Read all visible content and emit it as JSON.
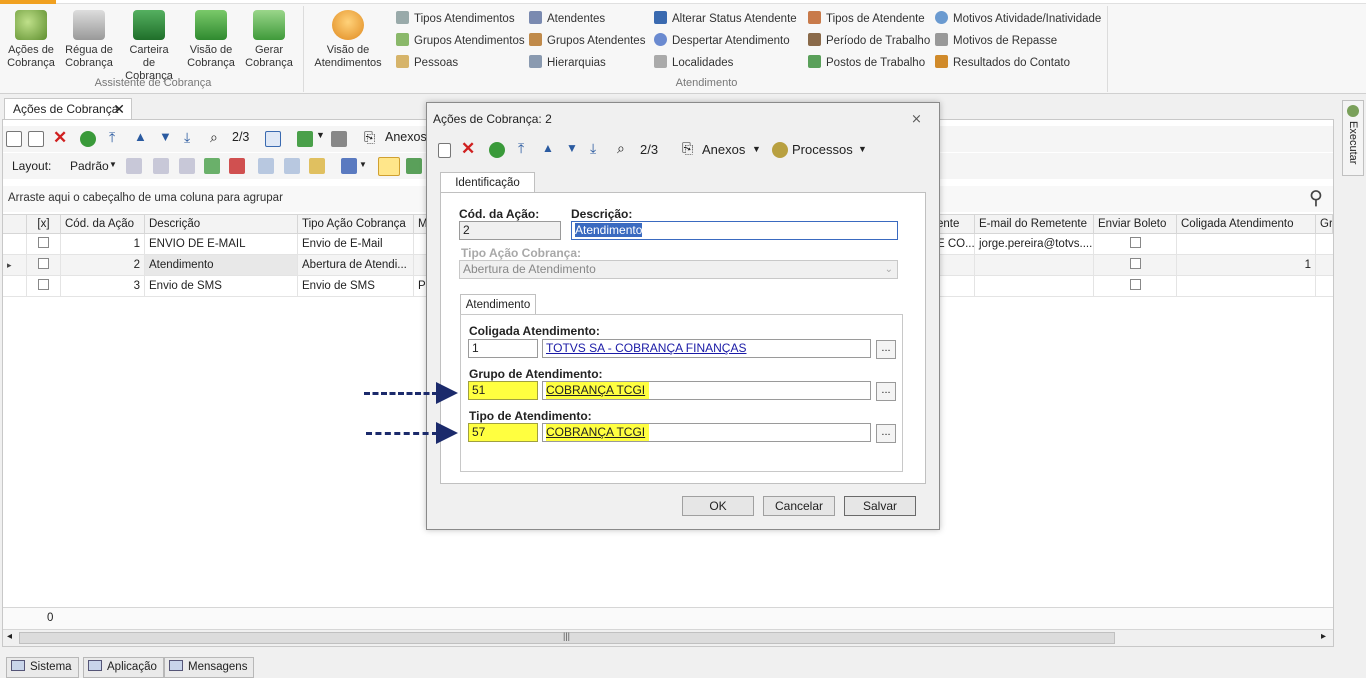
{
  "ribbon": {
    "group1": {
      "label": "Assistente de Cobrança",
      "buttons": [
        {
          "label1": "Ações de",
          "label2": "Cobrança",
          "icon": "actions-icon",
          "color": "#6a9a3a"
        },
        {
          "label1": "Régua de",
          "label2": "Cobrança",
          "icon": "ruler-icon",
          "color": "#8a8a8a"
        },
        {
          "label1": "Carteira de",
          "label2": "Cobrança",
          "icon": "wallet-icon",
          "color": "#2e8b3a"
        },
        {
          "label1": "Visão de",
          "label2": "Cobrança",
          "icon": "money-icon",
          "color": "#3a9a3a"
        },
        {
          "label1": "Gerar",
          "label2": "Cobrança",
          "icon": "generate-icon",
          "color": "#4aa040"
        }
      ]
    },
    "group2": {
      "label": "Atendimento",
      "big_button": {
        "label1": "Visão de",
        "label2": "Atendimentos",
        "icon": "headset-icon"
      },
      "col1": [
        "Tipos Atendimentos",
        "Grupos Atendimentos",
        "Pessoas"
      ],
      "col2": [
        "Atendentes",
        "Grupos Atendentes",
        "Hierarquias"
      ],
      "col3": [
        "Alterar Status Atendente",
        "Despertar Atendimento",
        "Localidades"
      ],
      "col4": [
        "Tipos de Atendente",
        "Período de Trabalho",
        "Postos de Trabalho"
      ],
      "col5": [
        "Motivos Atividade/Inatividade",
        "Motivos de Repasse",
        "Resultados do Contato"
      ]
    }
  },
  "doc_tab": {
    "label": "Ações de Cobrança",
    "close": "✕"
  },
  "main_toolbar": {
    "record_counter": "2/3",
    "attachments": "Anexos"
  },
  "layout_bar": {
    "layout_label": "Layout:",
    "layout_value": "Padrão"
  },
  "group_hint": "Arraste aqui o cabeçalho de uma coluna para agrupar",
  "grid": {
    "headers": {
      "check": "[x]",
      "code": "Cód. da Ação",
      "desc": "Descrição",
      "type": "Tipo Ação Cobrança",
      "m": "M",
      "ente": "ente",
      "email": "E-mail do Remetente",
      "boleto": "Enviar Boleto",
      "coligada": "Coligada Atendimento",
      "gr": "Gr"
    },
    "rows": [
      {
        "code": "1",
        "desc": "ENVIO DE E-MAIL",
        "type": "Envio de E-Mail",
        "m": "",
        "ente": "E CO...",
        "email": "jorge.pereira@totvs....",
        "coligada": ""
      },
      {
        "code": "2",
        "desc": "Atendimento",
        "type": "Abertura de Atendi...",
        "m": "",
        "ente": "",
        "email": "",
        "coligada": "1"
      },
      {
        "code": "3",
        "desc": "Envio de SMS",
        "type": "Envio de SMS",
        "m": "Pr",
        "ente": "",
        "email": "",
        "coligada": ""
      }
    ],
    "footer_count": "0"
  },
  "dialog": {
    "title": "Ações de Cobrança: 2",
    "record_counter": "2/3",
    "attachments": "Anexos",
    "processes": "Processos",
    "tab_identificacao": "Identificação",
    "code_label": "Cód. da Ação:",
    "code_value": "2",
    "desc_label": "Descrição:",
    "desc_value": "Atendimento",
    "type_label": "Tipo Ação Cobrança:",
    "type_value": "Abertura de Atendimento",
    "tab_atendimento": "Atendimento",
    "coligada_label": "Coligada Atendimento:",
    "coligada_code": "1",
    "coligada_name": "TOTVS SA - COBRANÇA FINANÇAS",
    "grupo_label": "Grupo de Atendimento:",
    "grupo_code": "51",
    "grupo_name": "COBRANÇA TCGI",
    "tipo_label": "Tipo de Atendimento:",
    "tipo_code": "57",
    "tipo_name": "COBRANÇA TCGI",
    "ellipsis": "...",
    "ok": "OK",
    "cancel": "Cancelar",
    "save": "Salvar"
  },
  "side_panel": {
    "label": "Executar"
  },
  "status_bar": {
    "sistema": "Sistema",
    "aplicacao": "Aplicação",
    "mensagens": "Mensagens"
  },
  "colors": {
    "highlight": "#ffff40",
    "arrow": "#1b2a6b",
    "link": "#1a1aa6",
    "accent": "#f0a020"
  }
}
